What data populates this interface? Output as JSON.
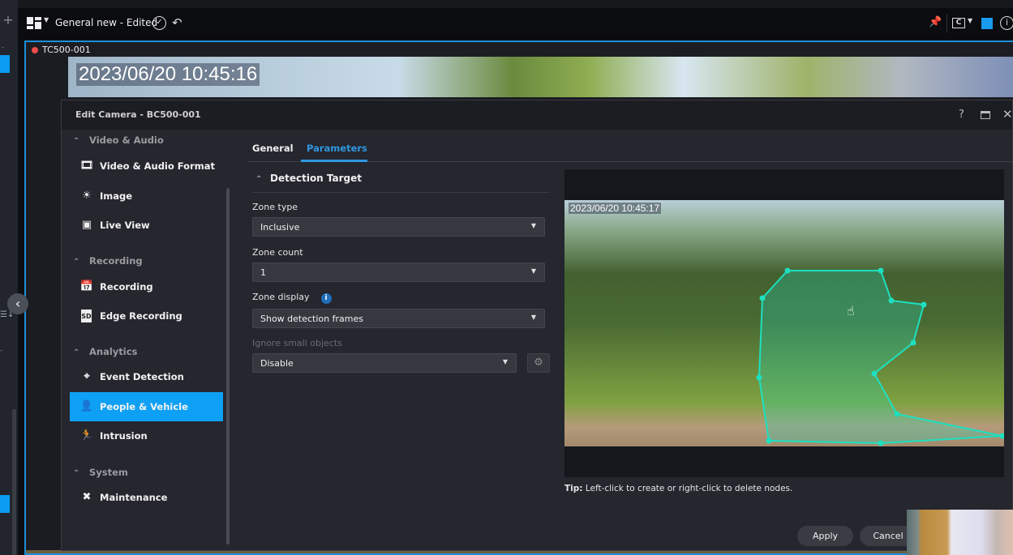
{
  "app": {
    "layout_title": "General new - Edited",
    "icons": {
      "layout": "layout-grid-icon",
      "confirm": "check-circle-icon",
      "undo": "undo-icon",
      "pin": "pin-icon",
      "camera_mode": "camera-c-icon",
      "fullscreen": "expand-icon",
      "info": "info-icon",
      "add": "plus-icon",
      "collapse": "chevron-left-icon"
    },
    "accent_color": "#0ea0f5"
  },
  "tile": {
    "camera_name": "TC500-001",
    "timestamp": "2023/06/20 10:45:16",
    "status_color": "#ee4b4b"
  },
  "dialog": {
    "title": "Edit Camera - BC500-001",
    "help_label": "?",
    "close_label": "✕",
    "nav": {
      "sections": [
        {
          "label": "Video & Audio",
          "items": [
            {
              "label": "Video & Audio Format",
              "icon": "film-icon"
            },
            {
              "label": "Image",
              "icon": "brightness-icon"
            },
            {
              "label": "Live View",
              "icon": "play-square-icon"
            }
          ]
        },
        {
          "label": "Recording",
          "items": [
            {
              "label": "Recording",
              "icon": "calendar-clock-icon"
            },
            {
              "label": "Edge Recording",
              "icon": "sd-card-icon"
            }
          ]
        },
        {
          "label": "Analytics",
          "items": [
            {
              "label": "Event Detection",
              "icon": "crosshair-icon"
            },
            {
              "label": "People & Vehicle",
              "icon": "people-vehicle-icon",
              "active": true
            },
            {
              "label": "Intrusion",
              "icon": "intrusion-icon"
            }
          ]
        },
        {
          "label": "System",
          "items": [
            {
              "label": "Maintenance",
              "icon": "tools-icon"
            }
          ]
        }
      ]
    },
    "tabs": [
      {
        "label": "General",
        "active": false
      },
      {
        "label": "Parameters",
        "active": true
      }
    ],
    "section_title": "Detection Target",
    "fields": {
      "zone_type": {
        "label": "Zone type",
        "value": "Inclusive"
      },
      "zone_count": {
        "label": "Zone count",
        "value": "1"
      },
      "zone_display": {
        "label": "Zone display",
        "value": "Show detection frames"
      },
      "ignore_small": {
        "label": "Ignore small objects",
        "value": "Disable",
        "disabled": true
      }
    },
    "preview": {
      "timestamp": "2023/06/20 10:45:17",
      "zone_color": "#1de0c0"
    },
    "tip": {
      "prefix": "Tip:",
      "text": " Left-click to create or right-click to delete nodes."
    },
    "buttons": {
      "apply": "Apply",
      "cancel": "Cancel"
    }
  }
}
